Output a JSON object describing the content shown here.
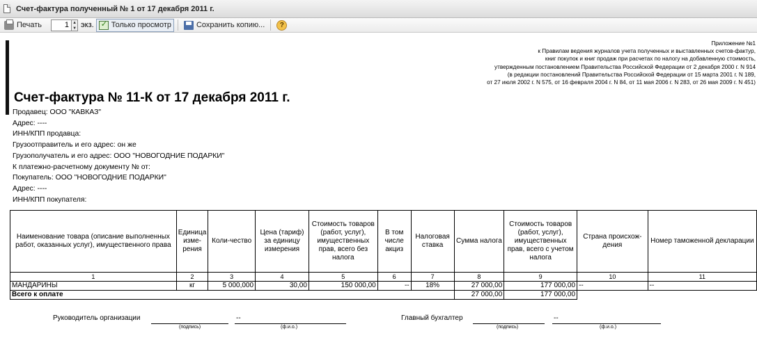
{
  "window": {
    "title": "Счет-фактура полученный № 1 от 17 декабря 2011 г."
  },
  "toolbar": {
    "print_label": "Печать",
    "copies": "1",
    "copies_unit": "экз.",
    "view_only_label": "Только просмотр",
    "save_copy_label": "Сохранить копию...",
    "help_label": "?"
  },
  "appendix": [
    "Приложение №1",
    "к Правилам ведения журналов учета полученных и выставленных счетов-фактур,",
    "книг покупок и книг продаж при расчетах по налогу на добавленную стоимость,",
    "утвержденным постановлением Правительства Российской Федерации от 2 декабря 2000 г. N 914",
    "(в редакции постановлений Правительства Российской Федерации от 15 марта 2001 г. N 189,",
    "от 27 июля 2002 г. N 575, от 16 февраля 2004 г. N 84, от 11 мая 2006 г. N 283, от 26 мая 2009 г. N 451)"
  ],
  "invoice": {
    "title": "Счет-фактура № 11-К от 17 декабря 2011 г.",
    "info": [
      "Продавец: ООО \"КАВКАЗ\"",
      "Адрес: ----",
      "ИНН/КПП продавца:",
      "Грузоотправитель и его адрес: он же",
      "Грузополучатель и его адрес: ООО \"НОВОГОДНИЕ ПОДАРКИ\"",
      "К платежно-расчетному документу №  от:",
      "Покупатель: ООО \"НОВОГОДНИЕ ПОДАРКИ\"",
      "Адрес: ----",
      "ИНН/КПП покупателя:"
    ]
  },
  "table": {
    "headers": [
      "Наименование товара (описание выполненных работ, оказанных услуг), имущественного права",
      "Единица изме-рения",
      "Коли-чество",
      "Цена (тариф) за единицу измерения",
      "Стоимость товаров (работ, услуг), имущественных прав, всего без налога",
      "В том числе акциз",
      "Налоговая ставка",
      "Сумма налога",
      "Стоимость товаров (работ, услуг), имущественных прав, всего с учетом налога",
      "Страна происхож-дения",
      "Номер таможенной декларации"
    ],
    "numbers": [
      "1",
      "2",
      "3",
      "4",
      "5",
      "6",
      "7",
      "8",
      "9",
      "10",
      "11"
    ],
    "rows": [
      [
        "МАНДАРИНЫ",
        "кг",
        "5 000,000",
        "30,00",
        "150 000,00",
        "--",
        "18%",
        "27 000,00",
        "177 000,00",
        "--",
        "--"
      ]
    ],
    "total": {
      "label": "Всего к оплате",
      "tax": "27 000,00",
      "sum": "177 000,00"
    }
  },
  "signatures": {
    "head_label": "Руководитель организации",
    "head_name": "--",
    "accountant_label": "Главный бухгалтер",
    "accountant_name": "--",
    "sign_caption": "(подпись)",
    "name_caption": "(ф.и.о.)"
  }
}
